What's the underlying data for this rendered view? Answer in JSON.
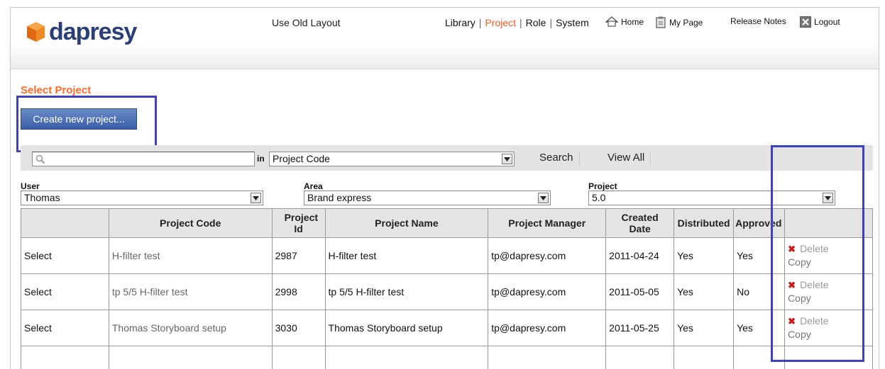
{
  "brand": {
    "name": "dapresy"
  },
  "header": {
    "old_layout": "Use Old Layout",
    "nav": [
      {
        "label": "Library",
        "active": false
      },
      {
        "label": "Project",
        "active": true
      },
      {
        "label": "Role",
        "active": false
      },
      {
        "label": "System",
        "active": false
      }
    ],
    "home": "Home",
    "my_page": "My Page",
    "release_notes": "Release Notes",
    "logout": "Logout"
  },
  "page": {
    "title": "Select Project",
    "create_button": "Create new project..."
  },
  "search": {
    "value": "",
    "in_label": "in",
    "field": "Project Code",
    "search_button": "Search",
    "view_all_button": "View All"
  },
  "filters": {
    "user": {
      "label": "User",
      "value": "Thomas"
    },
    "area": {
      "label": "Area",
      "value": "Brand express"
    },
    "project": {
      "label": "Project",
      "value": "5.0"
    }
  },
  "table": {
    "headers": [
      "",
      "Project Code",
      "Project Id",
      "Project Name",
      "Project Manager",
      "Created Date",
      "Distributed",
      "Approved",
      ""
    ],
    "rows": [
      {
        "select": "Select",
        "code": "H-filter test",
        "id": "2987",
        "name": "H-filter test",
        "manager": "tp@dapresy.com",
        "created": "2011-04-24",
        "distributed": "Yes",
        "approved": "Yes",
        "delete": "Delete",
        "copy": "Copy"
      },
      {
        "select": "Select",
        "code": "tp 5/5 H-filter test",
        "id": "2998",
        "name": "tp 5/5 H-filter test",
        "manager": "tp@dapresy.com",
        "created": "2011-05-05",
        "distributed": "Yes",
        "approved": "No",
        "delete": "Delete",
        "copy": "Copy"
      },
      {
        "select": "Select",
        "code": "Thomas Storyboard setup",
        "id": "3030",
        "name": "Thomas Storyboard setup",
        "manager": "tp@dapresy.com",
        "created": "2011-05-25",
        "distributed": "Yes",
        "approved": "Yes",
        "delete": "Delete",
        "copy": "Copy"
      }
    ]
  },
  "colors": {
    "accent": "#ff6a2a",
    "brand": "#2a3f78",
    "button": "#3a5ea8",
    "highlight": "#3d3fc4"
  }
}
